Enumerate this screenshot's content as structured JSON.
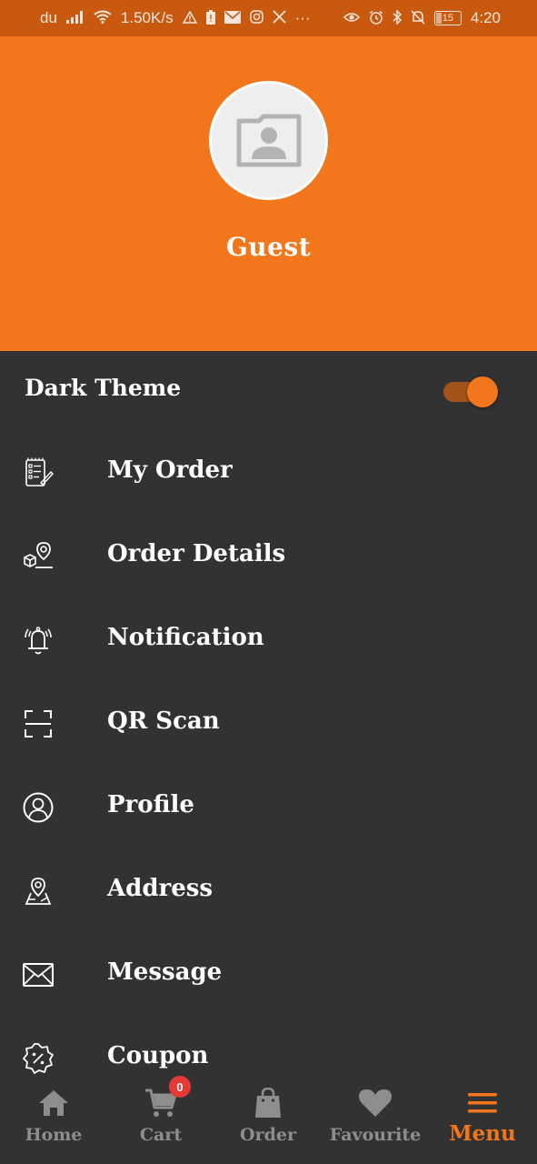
{
  "status_bar": {
    "carrier": "du",
    "speed": "1.50K/s",
    "battery": "15",
    "time": "4:20",
    "more": "···"
  },
  "header": {
    "user_name": "Guest"
  },
  "theme": {
    "label": "Dark Theme",
    "enabled": true
  },
  "menu": {
    "items": [
      {
        "label": "My Order",
        "icon": "order-list-icon"
      },
      {
        "label": "Order Details",
        "icon": "package-location-icon"
      },
      {
        "label": "Notification",
        "icon": "bell-icon"
      },
      {
        "label": "QR Scan",
        "icon": "qr-scan-icon"
      },
      {
        "label": "Profile",
        "icon": "profile-icon"
      },
      {
        "label": "Address",
        "icon": "map-pin-icon"
      },
      {
        "label": "Message",
        "icon": "envelope-icon"
      },
      {
        "label": "Coupon",
        "icon": "coupon-icon"
      }
    ]
  },
  "bottom_nav": {
    "items": [
      {
        "label": "Home",
        "icon": "home-icon"
      },
      {
        "label": "Cart",
        "icon": "cart-icon"
      },
      {
        "label": "Order",
        "icon": "shopping-bag-icon"
      },
      {
        "label": "Favourite",
        "icon": "heart-icon"
      },
      {
        "label": "Menu",
        "icon": "hamburger-icon"
      }
    ],
    "active": "Menu",
    "cart_badge": "0"
  },
  "colors": {
    "accent": "#f2761b",
    "status_bar": "#c9590f",
    "background": "#323232",
    "inactive": "#8e8e8e",
    "badge": "#e53935"
  }
}
